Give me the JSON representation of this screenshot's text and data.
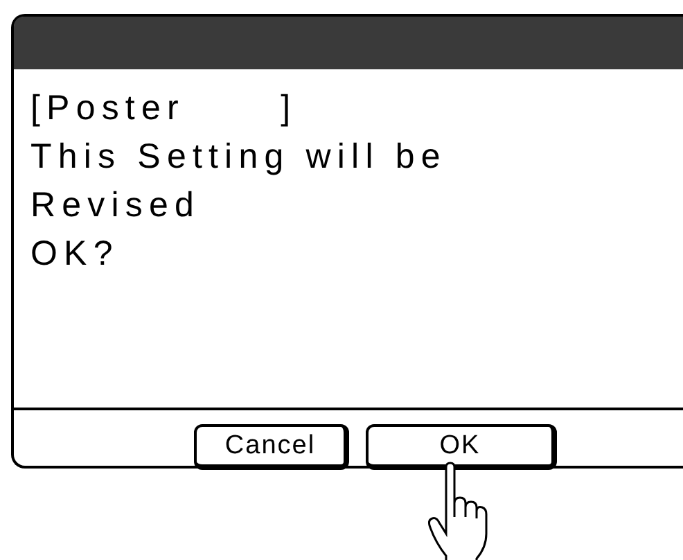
{
  "message": {
    "lines": [
      "[Poster      ]",
      "This Setting will be",
      "Revised",
      "OK?"
    ]
  },
  "buttons": [
    {
      "label": "Cancel"
    },
    {
      "label": "OK"
    }
  ]
}
